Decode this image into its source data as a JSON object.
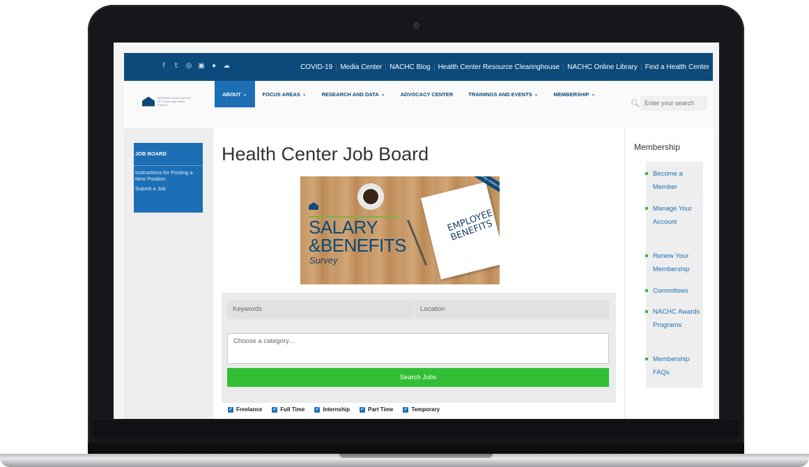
{
  "social": {
    "icons": [
      "facebook-icon",
      "twitter-icon",
      "instagram-icon",
      "youtube-icon",
      "flickr-icon",
      "soundcloud-icon"
    ],
    "glyphs": [
      "f",
      "𝕥",
      "◎",
      "▣",
      "●",
      "☁"
    ]
  },
  "top_links": [
    "COVID-19",
    "Media Center",
    "NACHC Blog",
    "Health Center Resource Clearinghouse",
    "NACHC Online Library",
    "Find a Health Center"
  ],
  "nav": {
    "items": [
      {
        "label": "ABOUT",
        "chevron": "⌄"
      },
      {
        "label": "FOCUS AREAS",
        "chevron": "⌄"
      },
      {
        "label": "RESEARCH AND DATA",
        "chevron": "⌄"
      },
      {
        "label": "ADVOCACY CENTER",
        "chevron": ""
      },
      {
        "label": "TRAININGS AND EVENTS",
        "chevron": "⌄"
      },
      {
        "label": "MEMBERSHIP",
        "chevron": "⌄"
      }
    ],
    "search_placeholder": "Enter your search"
  },
  "logo": {
    "text": "NATIONAL ASSOCIATION OF Community Health Centers"
  },
  "sidebar": {
    "header": "JOB BOARD",
    "links": [
      "Instructions for Posting a New Position",
      "Submit a Job"
    ]
  },
  "page": {
    "title": "Health Center Job Board"
  },
  "banner": {
    "line1": "SALARY",
    "line2": "&BENEFITS",
    "line3": "Survey",
    "notebook": "EMPLOYEE BENEFITS",
    "ribbon": "Survey closes March 2, 2020"
  },
  "form": {
    "keywords_placeholder": "Keywords",
    "location_placeholder": "Location",
    "category_placeholder": "Choose a category…",
    "search_button": "Search Jobs",
    "job_types": [
      "Freelance",
      "Full Time",
      "Internship",
      "Part Time",
      "Temporary"
    ]
  },
  "right": {
    "title": "Membership",
    "items": [
      "Become a Member",
      "Manage Your Account",
      "Renew Your Membership",
      "Committees",
      "NACHC Awards Programs",
      "Membership FAQs"
    ]
  },
  "colors": {
    "primary": "#0b4a7a",
    "accent": "#1c6fb5",
    "green": "#33bf35"
  }
}
